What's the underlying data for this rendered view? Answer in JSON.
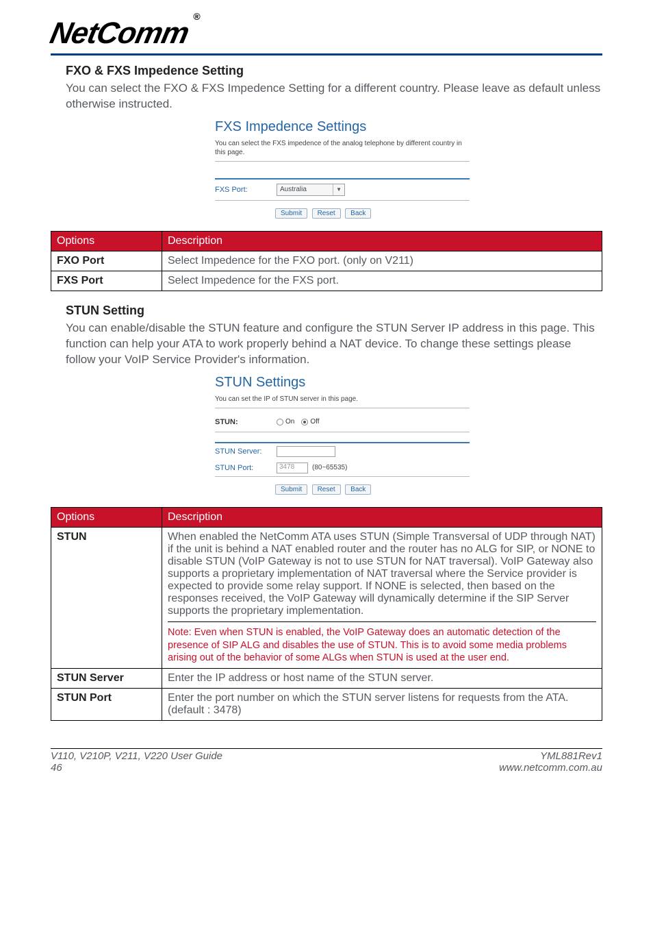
{
  "brand": {
    "name": "NetComm",
    "reg": "®"
  },
  "section1": {
    "title": "FXO & FXS Impedence Setting",
    "body": "You can select the FXO & FXS Impedence Setting for a different country. Please leave as default unless otherwise instructed."
  },
  "shot1": {
    "title": "FXS Impedence Settings",
    "desc": "You can select the FXS impedence of the analog telephone by different country in this page.",
    "port_label": "FXS Port:",
    "port_value": "Australia",
    "buttons": {
      "submit": "Submit",
      "reset": "Reset",
      "back": "Back"
    }
  },
  "table1": {
    "headers": {
      "options": "Options",
      "description": "Description"
    },
    "rows": [
      {
        "opt": "FXO Port",
        "desc": "Select Impedence for the FXO port. (only on V211)"
      },
      {
        "opt": "FXS Port",
        "desc": "Select Impedence for the FXS port."
      }
    ]
  },
  "section2": {
    "title": "STUN Setting",
    "body": "You can enable/disable the STUN feature and configure the STUN Server IP address in this page. This function can help your ATA to work properly behind a NAT device. To change these settings please follow your VoIP Service Provider's information."
  },
  "shot2": {
    "title": "STUN Settings",
    "desc": "You can set the IP of STUN server in this page.",
    "stun_label": "STUN:",
    "radio_on": "On",
    "radio_off": "Off",
    "server_label": "STUN Server:",
    "server_value": "",
    "port_label": "STUN Port:",
    "port_value": "3478",
    "port_range": "(80~65535)",
    "buttons": {
      "submit": "Submit",
      "reset": "Reset",
      "back": "Back"
    }
  },
  "table2": {
    "headers": {
      "options": "Options",
      "description": "Description"
    },
    "rows": [
      {
        "opt": "STUN",
        "desc": "When enabled the NetComm ATA uses STUN (Simple Transversal of UDP through NAT) if the unit is behind a NAT enabled router and the router has no ALG for SIP, or NONE to disable STUN (VoIP Gateway is not to use STUN for NAT traversal). VoIP Gateway also supports a proprietary implementation of NAT traversal where the Service provider is expected to provide some relay support. If NONE is selected, then based on the responses received, the VoIP Gateway will dynamically determine if the SIP Server supports the proprietary implementation.",
        "note": "Note:  Even when STUN is enabled, the VoIP Gateway does an automatic detection of the presence of SIP ALG and disables the use of STUN. This is to avoid some media problems arising out of the behavior of some ALGs when STUN is used at the user end."
      },
      {
        "opt": "STUN Server",
        "desc": "Enter the IP address or host name of the STUN server."
      },
      {
        "opt": "STUN Port",
        "desc": "Enter the port number on which the STUN server listens for requests from the ATA. (default : 3478)"
      }
    ]
  },
  "footer": {
    "guide": "V110, V210P, V211, V220 User Guide",
    "page": "46",
    "docid": "YML881Rev1",
    "url": "www.netcomm.com.au"
  }
}
